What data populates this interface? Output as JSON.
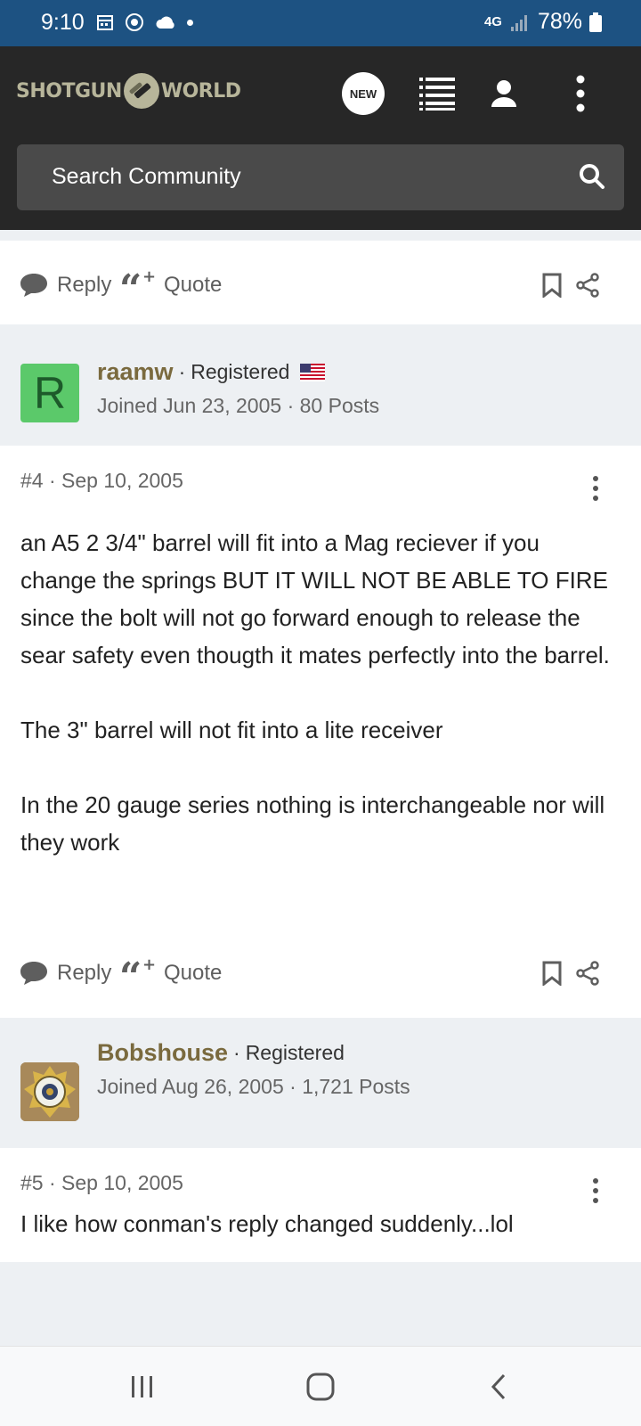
{
  "status_bar": {
    "time": "9:10",
    "network": "4G",
    "battery": "78%"
  },
  "header": {
    "logo_left": "SHOTGUN",
    "logo_right": "WORLD",
    "new_badge": "NEW"
  },
  "search": {
    "placeholder": "Search Community"
  },
  "actions": {
    "reply": "Reply",
    "quote": "Quote"
  },
  "posts": [
    {
      "author": {
        "username": "raamw",
        "role": "Registered",
        "avatar_letter": "R",
        "joined": "Joined Jun 23, 2005",
        "posts": "80 Posts"
      },
      "number": "#4",
      "date": "Sep 10, 2005",
      "paragraphs": [
        "an A5 2 3/4\" barrel will fit into a Mag reciever if you change the springs BUT IT WILL NOT BE ABLE TO FIRE since the bolt will not go forward enough to release the sear safety even thougth it mates perfectly into the barrel.",
        "The 3\" barrel will not fit into a lite receiver",
        "In the 20 gauge series nothing is interchangeable nor will they work"
      ]
    },
    {
      "author": {
        "username": "Bobshouse",
        "role": "Registered",
        "joined": "Joined Aug 26, 2005",
        "posts": "1,721 Posts"
      },
      "number": "#5",
      "date": "Sep 10, 2005",
      "paragraphs": [
        "I like how conman's reply changed suddenly...lol"
      ]
    }
  ],
  "colors": {
    "status_bar": "#1d5282",
    "header": "#272727",
    "username": "#7a6a3e",
    "avatar_r": "#5bc96a"
  }
}
